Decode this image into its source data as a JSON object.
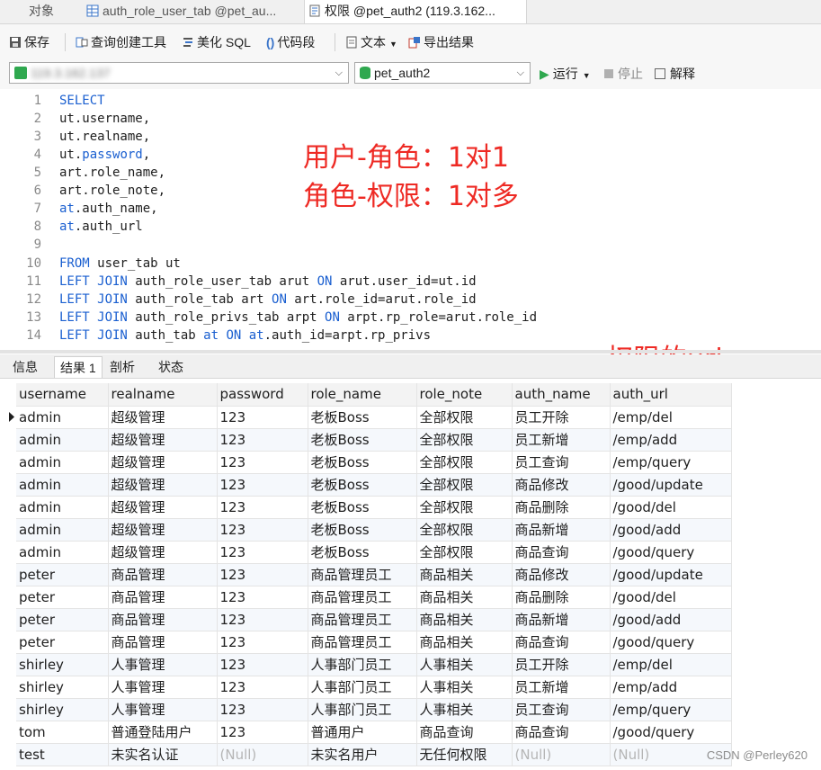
{
  "tabs": [
    {
      "label": "对象",
      "active": false
    },
    {
      "label": "auth_role_user_tab @pet_au...",
      "active": false
    },
    {
      "label": "权限 @pet_auth2 (119.3.162...",
      "active": true
    }
  ],
  "toolbar": {
    "save": "保存",
    "query_builder": "查询创建工具",
    "beautify": "美化 SQL",
    "snippet": "代码段",
    "text": "文本",
    "export": "导出结果"
  },
  "connection": {
    "server": "119.3.162.137",
    "database": "pet_auth2",
    "run": "运行",
    "stop": "停止",
    "explain": "解释"
  },
  "editor": {
    "lines": [
      {
        "n": "1",
        "parts": [
          [
            "kw",
            "SELECT"
          ]
        ]
      },
      {
        "n": "2",
        "parts": [
          [
            "tx",
            "ut.username,"
          ]
        ]
      },
      {
        "n": "3",
        "parts": [
          [
            "tx",
            "ut.realname,"
          ]
        ]
      },
      {
        "n": "4",
        "parts": [
          [
            "tx",
            "ut."
          ],
          [
            "kw",
            "password"
          ],
          [
            "tx",
            ","
          ]
        ]
      },
      {
        "n": "5",
        "parts": [
          [
            "tx",
            "art.role_name,"
          ]
        ]
      },
      {
        "n": "6",
        "parts": [
          [
            "tx",
            "art.role_note,"
          ]
        ]
      },
      {
        "n": "7",
        "parts": [
          [
            "kw",
            "at"
          ],
          [
            "tx",
            ".auth_name,"
          ]
        ]
      },
      {
        "n": "8",
        "parts": [
          [
            "kw",
            "at"
          ],
          [
            "tx",
            ".auth_url"
          ]
        ]
      },
      {
        "n": "9",
        "parts": []
      },
      {
        "n": "10",
        "parts": [
          [
            "kw",
            "FROM"
          ],
          [
            "tx",
            " user_tab ut"
          ]
        ]
      },
      {
        "n": "11",
        "parts": [
          [
            "kw",
            "LEFT JOIN"
          ],
          [
            "tx",
            " auth_role_user_tab arut "
          ],
          [
            "kw",
            "ON"
          ],
          [
            "tx",
            " arut.user_id=ut.id"
          ]
        ]
      },
      {
        "n": "12",
        "parts": [
          [
            "kw",
            "LEFT JOIN"
          ],
          [
            "tx",
            " auth_role_tab art "
          ],
          [
            "kw",
            "ON"
          ],
          [
            "tx",
            " art.role_id=arut.role_id"
          ]
        ]
      },
      {
        "n": "13",
        "parts": [
          [
            "kw",
            "LEFT JOIN"
          ],
          [
            "tx",
            " auth_role_privs_tab arpt "
          ],
          [
            "kw",
            "ON"
          ],
          [
            "tx",
            " arpt.rp_role=arut.role_id"
          ]
        ]
      },
      {
        "n": "14",
        "parts": [
          [
            "kw",
            "LEFT JOIN"
          ],
          [
            "tx",
            " auth_tab "
          ],
          [
            "kw",
            "at ON at"
          ],
          [
            "tx",
            ".auth_id=arpt.rp_privs"
          ]
        ]
      }
    ]
  },
  "annotations": {
    "line1": "用户-角色：1对1",
    "line2": "角色-权限：1对多",
    "url_note": "权限的url"
  },
  "result_tabs": [
    {
      "label": "信息",
      "active": false
    },
    {
      "label": "结果 1",
      "active": true
    },
    {
      "label": "剖析",
      "active": false
    },
    {
      "label": "状态",
      "active": false
    }
  ],
  "grid": {
    "columns": [
      "username",
      "realname",
      "password",
      "role_name",
      "role_note",
      "auth_name",
      "auth_url"
    ],
    "rows": [
      [
        "admin",
        "超级管理",
        "123",
        "老板Boss",
        "全部权限",
        "员工开除",
        "/emp/del"
      ],
      [
        "admin",
        "超级管理",
        "123",
        "老板Boss",
        "全部权限",
        "员工新增",
        "/emp/add"
      ],
      [
        "admin",
        "超级管理",
        "123",
        "老板Boss",
        "全部权限",
        "员工查询",
        "/emp/query"
      ],
      [
        "admin",
        "超级管理",
        "123",
        "老板Boss",
        "全部权限",
        "商品修改",
        "/good/update"
      ],
      [
        "admin",
        "超级管理",
        "123",
        "老板Boss",
        "全部权限",
        "商品删除",
        "/good/del"
      ],
      [
        "admin",
        "超级管理",
        "123",
        "老板Boss",
        "全部权限",
        "商品新增",
        "/good/add"
      ],
      [
        "admin",
        "超级管理",
        "123",
        "老板Boss",
        "全部权限",
        "商品查询",
        "/good/query"
      ],
      [
        "peter",
        "商品管理",
        "123",
        "商品管理员工",
        "商品相关",
        "商品修改",
        "/good/update"
      ],
      [
        "peter",
        "商品管理",
        "123",
        "商品管理员工",
        "商品相关",
        "商品删除",
        "/good/del"
      ],
      [
        "peter",
        "商品管理",
        "123",
        "商品管理员工",
        "商品相关",
        "商品新增",
        "/good/add"
      ],
      [
        "peter",
        "商品管理",
        "123",
        "商品管理员工",
        "商品相关",
        "商品查询",
        "/good/query"
      ],
      [
        "shirley",
        "人事管理",
        "123",
        "人事部门员工",
        "人事相关",
        "员工开除",
        "/emp/del"
      ],
      [
        "shirley",
        "人事管理",
        "123",
        "人事部门员工",
        "人事相关",
        "员工新增",
        "/emp/add"
      ],
      [
        "shirley",
        "人事管理",
        "123",
        "人事部门员工",
        "人事相关",
        "员工查询",
        "/emp/query"
      ],
      [
        "tom",
        "普通登陆用户",
        "123",
        "普通用户",
        "商品查询",
        "商品查询",
        "/good/query"
      ],
      [
        "test",
        "未实名认证",
        "(Null)",
        "未实名用户",
        "无任何权限",
        "(Null)",
        "(Null)"
      ]
    ]
  },
  "watermark": "CSDN @Perley620",
  "colors": {
    "keyword": "#1a5fd0",
    "annotation": "#ee2a24",
    "null_text": "#b5b5b5"
  }
}
